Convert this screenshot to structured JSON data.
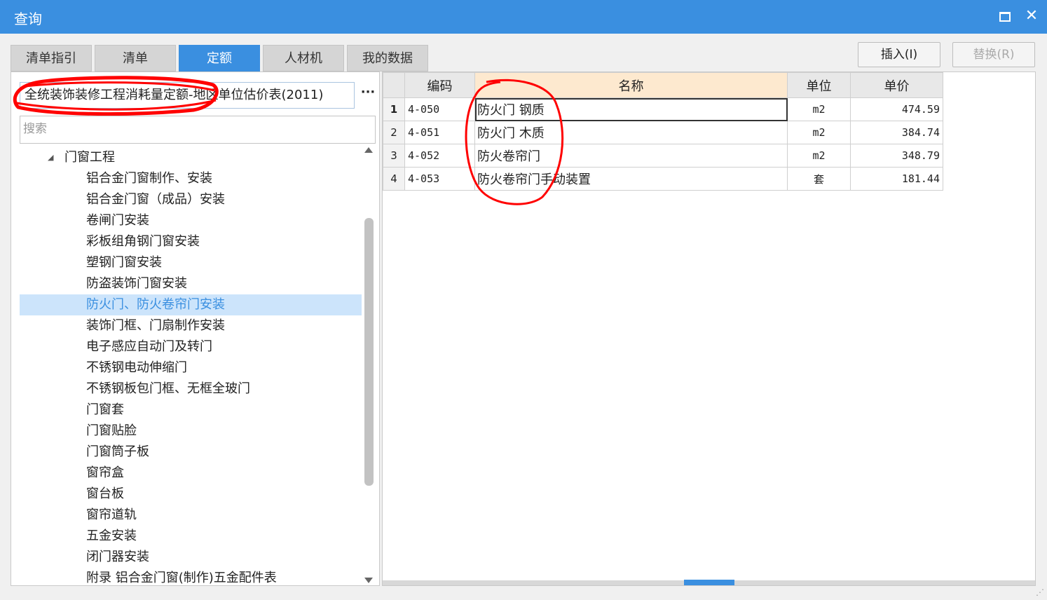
{
  "window": {
    "title": "查询",
    "maximize_icon": "maximize-icon",
    "close_glyph": "✕"
  },
  "tabs": [
    "清单指引",
    "清单",
    "定额",
    "人材机",
    "我的数据"
  ],
  "active_tab": 2,
  "buttons": {
    "insert": "插入(I)",
    "replace": "替换(R)"
  },
  "library": {
    "selected": "全统装饰装修工程消耗量定额-地区单位估价表(2011)",
    "more": "···"
  },
  "search": {
    "placeholder": "搜索",
    "value": ""
  },
  "tree": {
    "parent": "门窗工程",
    "items": [
      "铝合金门窗制作、安装",
      "铝合金门窗（成品）安装",
      "卷闸门安装",
      "彩板组角钢门窗安装",
      "塑钢门窗安装",
      "防盗装饰门窗安装",
      "防火门、防火卷帘门安装",
      "装饰门框、门扇制作安装",
      "电子感应自动门及转门",
      "不锈钢电动伸缩门",
      "不锈钢板包门框、无框全玻门",
      "门窗套",
      "门窗贴脸",
      "门窗筒子板",
      "窗帘盒",
      "窗台板",
      "窗帘道轨",
      "五金安装",
      "闭门器安装",
      "附录 铝合金门窗(制作)五金配件表"
    ],
    "selected_index": 6
  },
  "grid": {
    "headers": {
      "code": "编码",
      "name": "名称",
      "unit": "单位",
      "price": "单价"
    },
    "rows": [
      {
        "no": "1",
        "code": "4-050",
        "name": "防火门 钢质",
        "unit": "m2",
        "price": "474.59"
      },
      {
        "no": "2",
        "code": "4-051",
        "name": "防火门 木质",
        "unit": "m2",
        "price": "384.74"
      },
      {
        "no": "3",
        "code": "4-052",
        "name": "防火卷帘门",
        "unit": "m2",
        "price": "348.79"
      },
      {
        "no": "4",
        "code": "4-053",
        "name": "防火卷帘门手动装置",
        "unit": "套",
        "price": "181.44"
      }
    ]
  },
  "colors": {
    "accent": "#3a8fe0",
    "annotation": "#ff0000",
    "selected_bg": "#cce4fb",
    "header_highlight": "#fde9cf"
  }
}
